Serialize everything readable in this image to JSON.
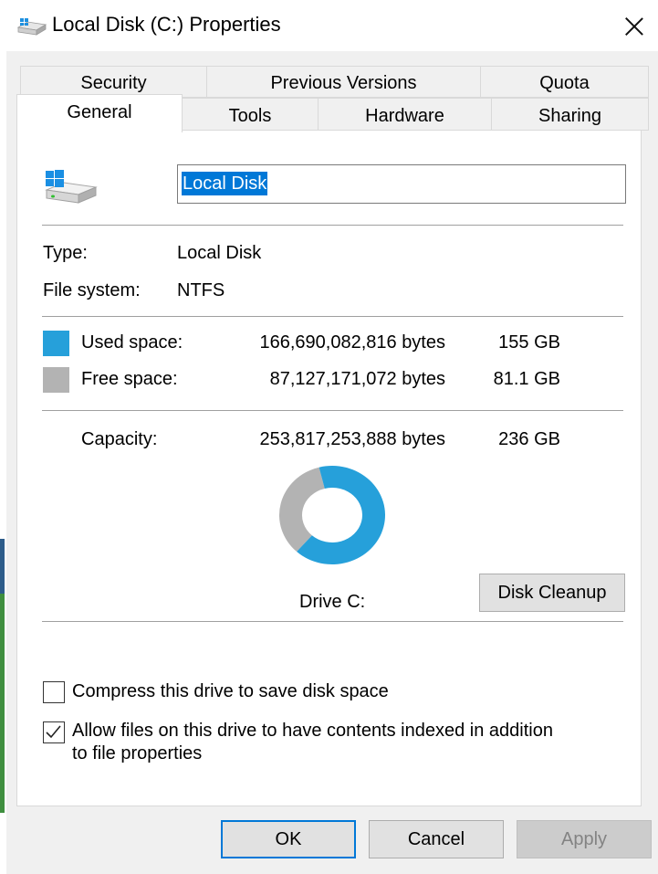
{
  "window": {
    "title": "Local Disk (C:) Properties",
    "icon": "drive-icon",
    "close_icon": "close-icon"
  },
  "tabs": {
    "row1": [
      "Security",
      "Previous Versions",
      "Quota"
    ],
    "row2": [
      "General",
      "Tools",
      "Hardware",
      "Sharing"
    ],
    "active": "General"
  },
  "general": {
    "drive_name": "Local Disk",
    "type_label": "Type:",
    "type_value": "Local Disk",
    "fs_label": "File system:",
    "fs_value": "NTFS",
    "used": {
      "label": "Used space:",
      "bytes": "166,690,082,816 bytes",
      "size": "155 GB",
      "color": "#26a0da"
    },
    "free": {
      "label": "Free space:",
      "bytes": "87,127,171,072 bytes",
      "size": "81.1 GB",
      "color": "#b3b3b3"
    },
    "capacity": {
      "label": "Capacity:",
      "bytes": "253,817,253,888 bytes",
      "size": "236 GB"
    },
    "chart_label": "Drive C:",
    "used_fraction": 0.657,
    "cleanup_label": "Disk Cleanup",
    "compress_label": "Compress this drive to save disk space",
    "compress_checked": false,
    "index_label_line1": "Allow files on this drive to have contents indexed in addition",
    "index_label_line2": "to file properties",
    "index_checked": true
  },
  "buttons": {
    "ok": "OK",
    "cancel": "Cancel",
    "apply": "Apply"
  }
}
